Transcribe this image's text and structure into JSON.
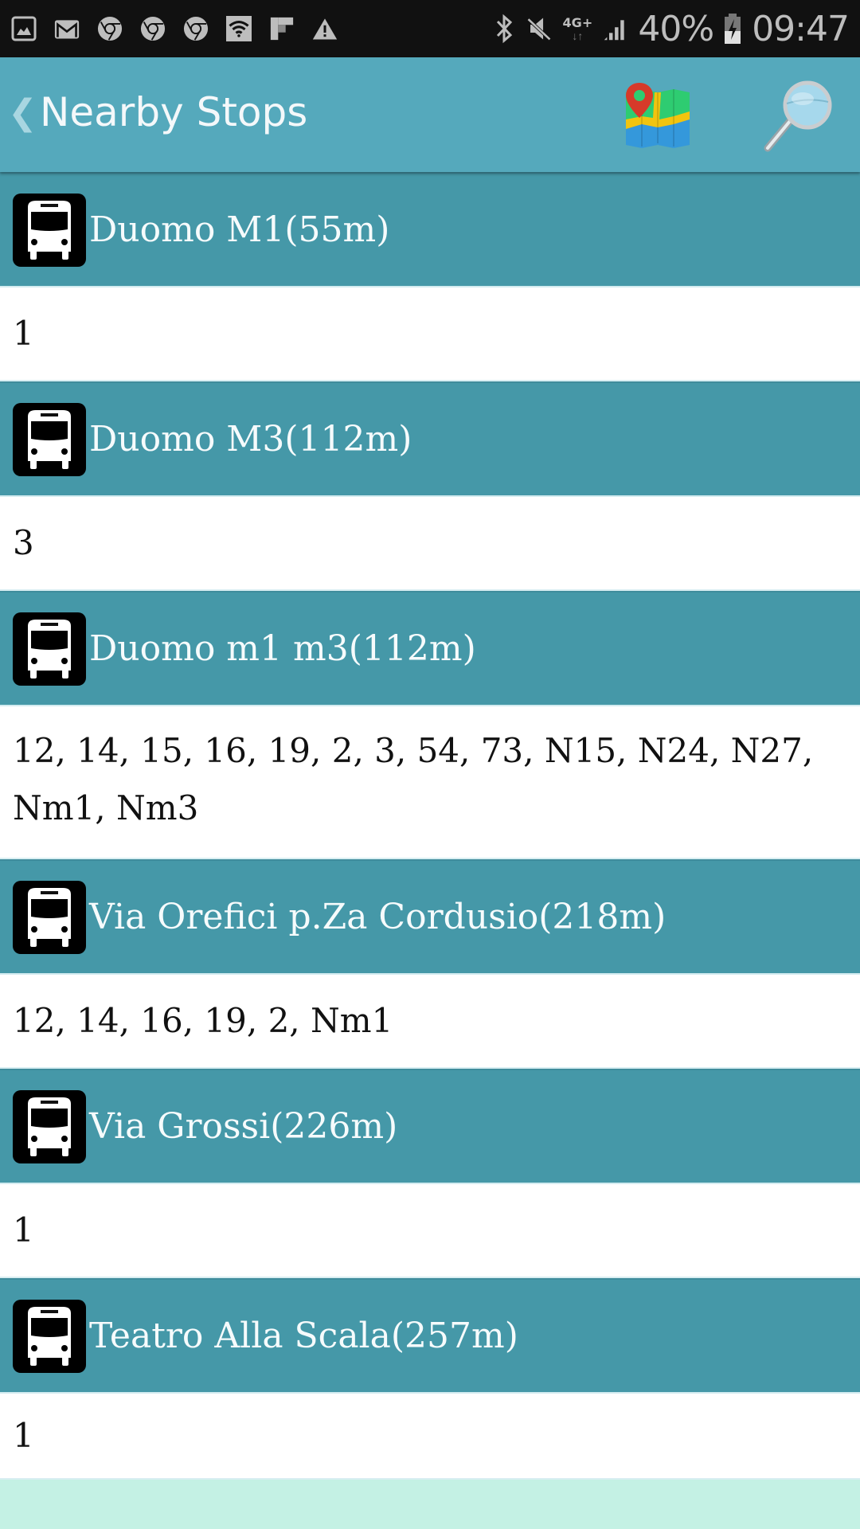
{
  "status_bar": {
    "left_icons": [
      "gallery-icon",
      "gmail-icon",
      "chrome-icon",
      "chrome-icon",
      "chrome-icon",
      "wifi-icon",
      "flipboard-icon",
      "warning-icon"
    ],
    "right_icons": [
      "bluetooth-icon",
      "mute-icon",
      "network-4g-plus-icon",
      "signal-icon"
    ],
    "network_label": "4G+",
    "battery_percent": "40%",
    "battery_charging": true,
    "time": "09:47"
  },
  "app_bar": {
    "back_glyph": "❮",
    "title": "Nearby Stops",
    "actions": [
      {
        "name": "map-button",
        "icon": "map-icon"
      },
      {
        "name": "search-button",
        "icon": "magnifier-icon"
      }
    ]
  },
  "stops": [
    {
      "name": "Duomo M1(55m)",
      "lines": "1"
    },
    {
      "name": "Duomo M3(112m)",
      "lines": "3"
    },
    {
      "name": "Duomo m1 m3(112m)",
      "lines": "12, 14, 15, 16, 19, 2, 3, 54, 73, N15, N24, N27, Nm1, Nm3"
    },
    {
      "name": "Via Orefici p.Za Cordusio(218m)",
      "lines": "12, 14, 16, 19, 2, Nm1"
    },
    {
      "name": "Via Grossi(226m)",
      "lines": "1"
    },
    {
      "name": "Teatro Alla Scala(257m)",
      "lines": "1"
    }
  ],
  "colors": {
    "status_bar_bg": "#111111",
    "app_bar_bg": "#55a9bc",
    "stop_header_bg": "#4598a8",
    "stop_body_bg": "#ffffff",
    "page_bg": "#c4f1e4"
  }
}
